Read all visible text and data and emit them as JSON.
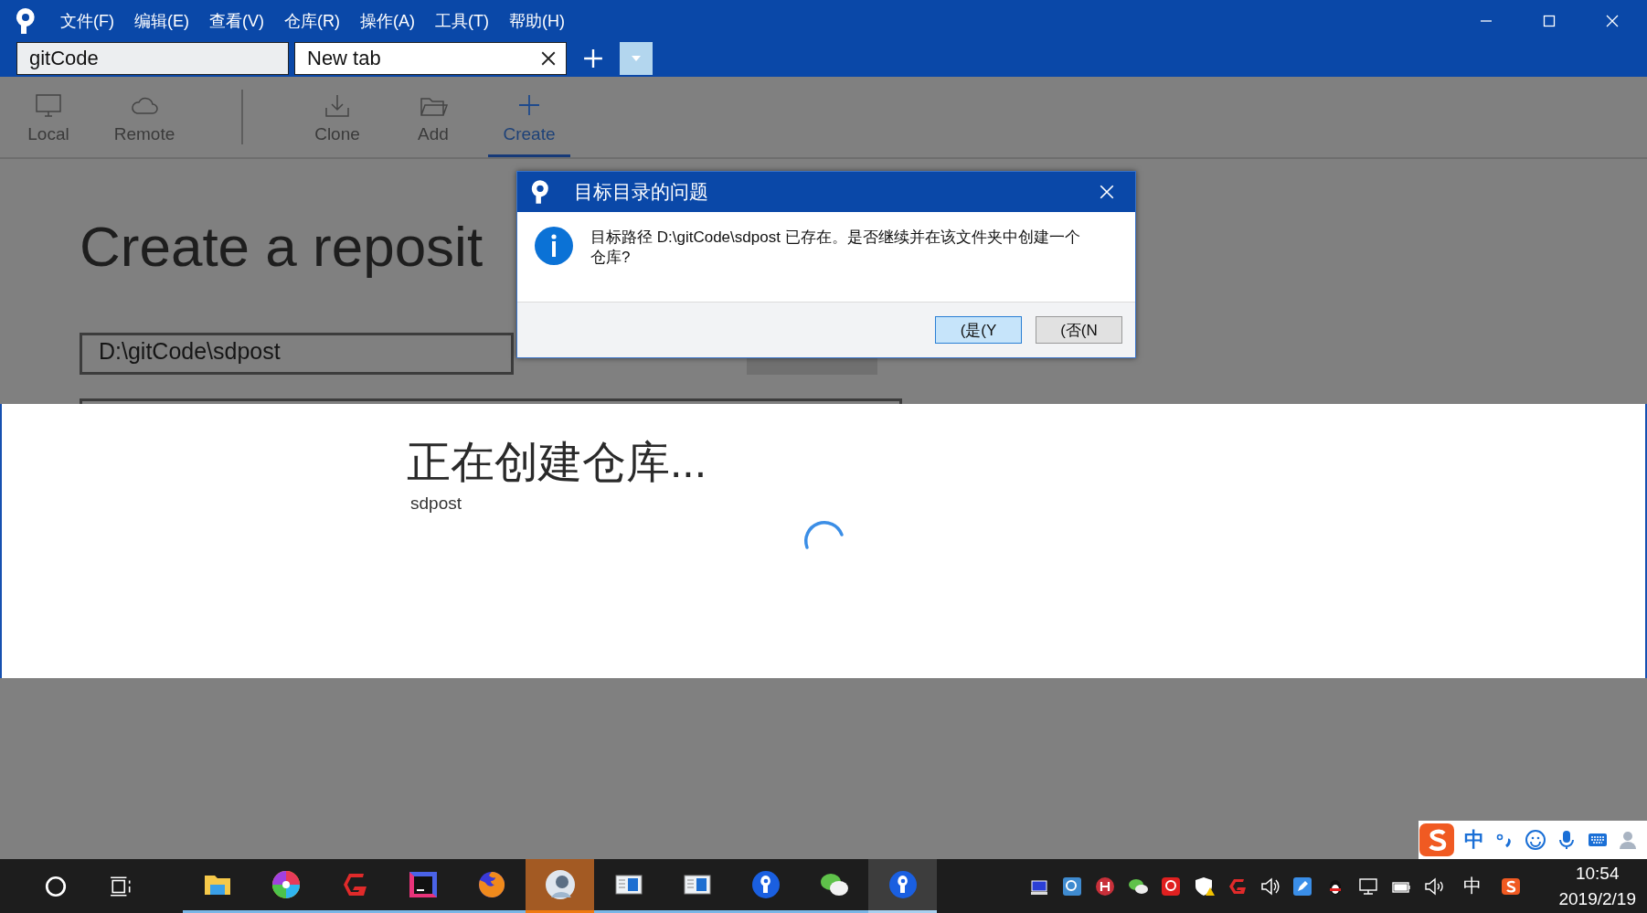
{
  "window": {
    "menu": [
      "文件(F)",
      "编辑(E)",
      "查看(V)",
      "仓库(R)",
      "操作(A)",
      "工具(T)",
      "帮助(H)"
    ],
    "tabs": [
      {
        "label": "gitCode",
        "selected": false
      },
      {
        "label": "New tab",
        "selected": true
      }
    ]
  },
  "toolbar": [
    {
      "label": "Local",
      "kind": "monitor",
      "selected": false
    },
    {
      "label": "Remote",
      "kind": "cloud",
      "selected": false
    },
    {
      "label": "Clone",
      "kind": "download",
      "selected": false
    },
    {
      "label": "Add",
      "kind": "folder",
      "selected": false
    },
    {
      "label": "Create",
      "kind": "plus",
      "selected": true
    }
  ],
  "page": {
    "title": "Create a reposit",
    "path": "D:\\gitCode\\sdpost"
  },
  "progress": {
    "title": "正在创建仓库...",
    "subtitle": "sdpost"
  },
  "dialog": {
    "title": "目标目录的问题",
    "message": "目标路径 D:\\gitCode\\sdpost 已存在。是否继续并在该文件夹中创建一个仓库?",
    "buttons": [
      {
        "label": "(是(Y",
        "selected": true
      },
      {
        "label": "(否(N",
        "selected": false
      }
    ]
  },
  "ime": {
    "label": "中"
  },
  "taskbar": {
    "apps": [
      {
        "kind": "folder",
        "running": true,
        "flashing": false,
        "selected": false
      },
      {
        "kind": "pinwheel",
        "running": true,
        "flashing": false,
        "selected": false
      },
      {
        "kind": "g-logo",
        "running": true,
        "flashing": false,
        "selected": false
      },
      {
        "kind": "ij",
        "running": true,
        "flashing": false,
        "selected": false
      },
      {
        "kind": "fox",
        "running": true,
        "flashing": false,
        "selected": false
      },
      {
        "kind": "avatar",
        "running": true,
        "flashing": true,
        "selected": false
      },
      {
        "kind": "window",
        "running": true,
        "flashing": false,
        "selected": false
      },
      {
        "kind": "window",
        "running": true,
        "flashing": false,
        "selected": false
      },
      {
        "kind": "pin",
        "running": true,
        "flashing": false,
        "selected": false
      },
      {
        "kind": "chat",
        "running": true,
        "flashing": false,
        "selected": false
      },
      {
        "kind": "pin",
        "running": true,
        "flashing": false,
        "selected": true
      }
    ],
    "tray": [
      {
        "kind": "computer"
      },
      {
        "kind": "magnifier"
      },
      {
        "kind": "h-circle"
      },
      {
        "kind": "chat"
      },
      {
        "kind": "app-tile"
      },
      {
        "kind": "shield"
      },
      {
        "kind": "g-logo"
      },
      {
        "kind": "speaker"
      },
      {
        "kind": "pen"
      },
      {
        "kind": "penguin"
      },
      {
        "kind": "network"
      },
      {
        "kind": "battery"
      },
      {
        "kind": "volume"
      }
    ],
    "language": "中",
    "time": "10:54",
    "date": "2019/2/19"
  }
}
